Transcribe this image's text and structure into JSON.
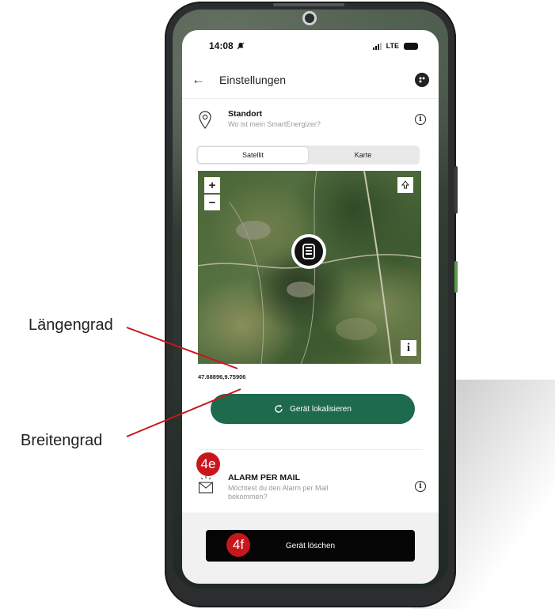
{
  "status_bar": {
    "time": "14:08",
    "network": "LTE"
  },
  "app_bar": {
    "back_icon": "arrow-left-icon",
    "title": "Einstellungen",
    "action_icon": "palette-icon"
  },
  "location": {
    "title": "Standort",
    "subtitle": "Wo ist mein SmartEnergizer?",
    "icon": "location-pin-icon",
    "info_glyph": "i"
  },
  "map_toggle": {
    "options": [
      "Satellit",
      "Karte"
    ],
    "selected": "Satellit"
  },
  "map": {
    "zoom_in": "+",
    "zoom_out": "−",
    "info_label": "i",
    "compass_icon": "navigation-icon",
    "marker_icon": "device-icon"
  },
  "coordinates": "47.68896,9.75906",
  "locate_button": {
    "label": "Gerät lokalisieren",
    "icon": "refresh-icon"
  },
  "alarm_mail": {
    "title": "ALARM PER MAIL",
    "subtitle": "Möchtest du den Alarm per Mail bekommen?",
    "icon": "mail-icon",
    "info_glyph": "i"
  },
  "delete_button": {
    "label": "Gerät löschen"
  },
  "annotations": {
    "longitude_label": "Längengrad",
    "latitude_label": "Breitengrad",
    "badge_4e": "4e",
    "badge_4f": "4f",
    "badge_color": "#c8161d"
  },
  "colors": {
    "primary_green": "#1d6a4d",
    "delete_black": "#050505"
  }
}
